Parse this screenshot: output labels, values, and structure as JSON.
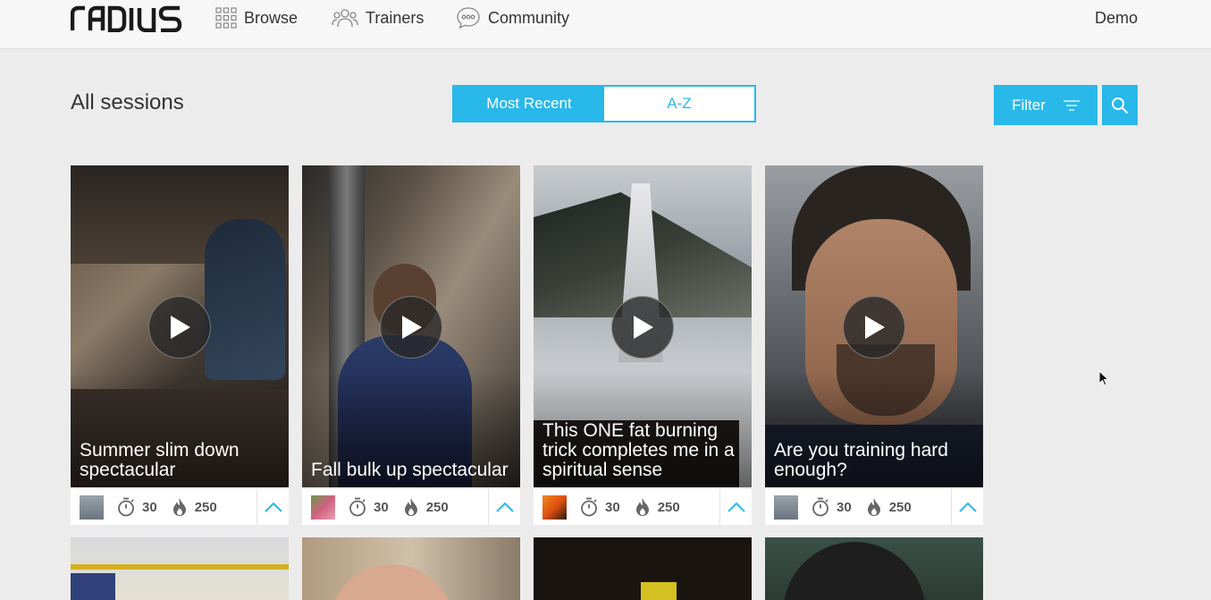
{
  "nav": {
    "logo_alt": "radius",
    "browse": "Browse",
    "trainers": "Trainers",
    "community": "Community",
    "user": "Demo"
  },
  "page": {
    "title": "All sessions",
    "sort_options": [
      "Most Recent",
      "A-Z"
    ],
    "sort_active": "Most Recent",
    "filter_label": "Filter"
  },
  "colors": {
    "accent": "#29b8ea",
    "background": "#ececec"
  },
  "sessions": [
    {
      "title": "Summer slim down spectacular",
      "duration": "30",
      "calories": "250"
    },
    {
      "title": "Fall bulk up spectacular",
      "duration": "30",
      "calories": "250"
    },
    {
      "title": "This ONE fat burning trick completes me in a spiritual sense",
      "duration": "30",
      "calories": "250"
    },
    {
      "title": "Are you training hard enough?",
      "duration": "30",
      "calories": "250"
    }
  ],
  "icons": {
    "browse": "grid-icon",
    "trainers": "people-icon",
    "community": "chat-bubble-icon",
    "filter": "filter-lines-icon",
    "search": "search-icon",
    "play": "play-icon",
    "duration": "stopwatch-icon",
    "calories": "flame-icon",
    "expand": "chevron-up-icon"
  }
}
